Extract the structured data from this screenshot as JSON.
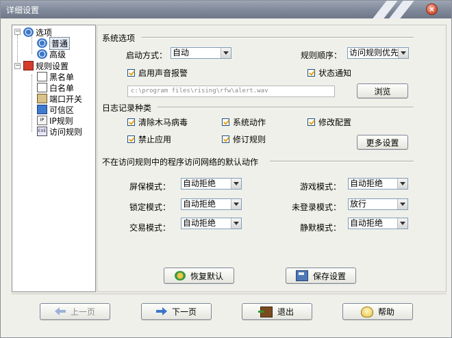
{
  "window": {
    "title": "详细设置"
  },
  "tree": {
    "root_options": "选项",
    "options_general": "普通",
    "options_advanced": "高级",
    "root_rules": "规则设置",
    "rules_blacklist": "黑名单",
    "rules_whitelist": "白名单",
    "rules_port_switch": "端口开关",
    "rules_trusted_zone": "可信区",
    "rules_ip": "IP规则",
    "rules_access": "访问规则",
    "ip_icon_text": "IP",
    "exe_icon_text": "EXE"
  },
  "system_options": {
    "section_title": "系统选项",
    "startup_label": "启动方式：",
    "startup_value": "自动",
    "rule_order_label": "规则顺序：",
    "rule_order_value": "访问规则优先",
    "sound_alarm_label": "启用声音报警",
    "sound_alarm_checked": true,
    "status_notify_label": "状态通知",
    "status_notify_checked": true,
    "sound_path": "c:\\program files\\rising\\rfw\\alert.wav",
    "browse_label": "浏览"
  },
  "log_types": {
    "section_title": "日志记录种类",
    "items": [
      {
        "label": "清除木马病毒",
        "checked": true
      },
      {
        "label": "系统动作",
        "checked": true
      },
      {
        "label": "修改配置",
        "checked": true
      },
      {
        "label": "禁止应用",
        "checked": true
      },
      {
        "label": "修订规则",
        "checked": true
      }
    ],
    "more_settings_label": "更多设置"
  },
  "default_actions": {
    "section_title": "不在访问规则中的程序访问网络的默认动作",
    "screensaver_label": "屏保模式：",
    "screensaver_value": "自动拒绝",
    "game_label": "游戏模式：",
    "game_value": "自动拒绝",
    "lock_label": "锁定模式：",
    "lock_value": "自动拒绝",
    "not_logged_label": "未登录模式：",
    "not_logged_value": "放行",
    "trade_label": "交易模式：",
    "trade_value": "自动拒绝",
    "silent_label": "静默模式：",
    "silent_value": "自动拒绝"
  },
  "actions": {
    "restore_default_label": "恢复默认",
    "save_settings_label": "保存设置"
  },
  "footer": {
    "prev_label": "上一页",
    "next_label": "下一页",
    "exit_label": "退出",
    "help_label": "帮助"
  },
  "colors": {
    "titlebar": "#7f8898",
    "window_bg": "#f0f0ea",
    "checkmark": "#e3a21a",
    "arrow_blue": "#3b74c9"
  }
}
